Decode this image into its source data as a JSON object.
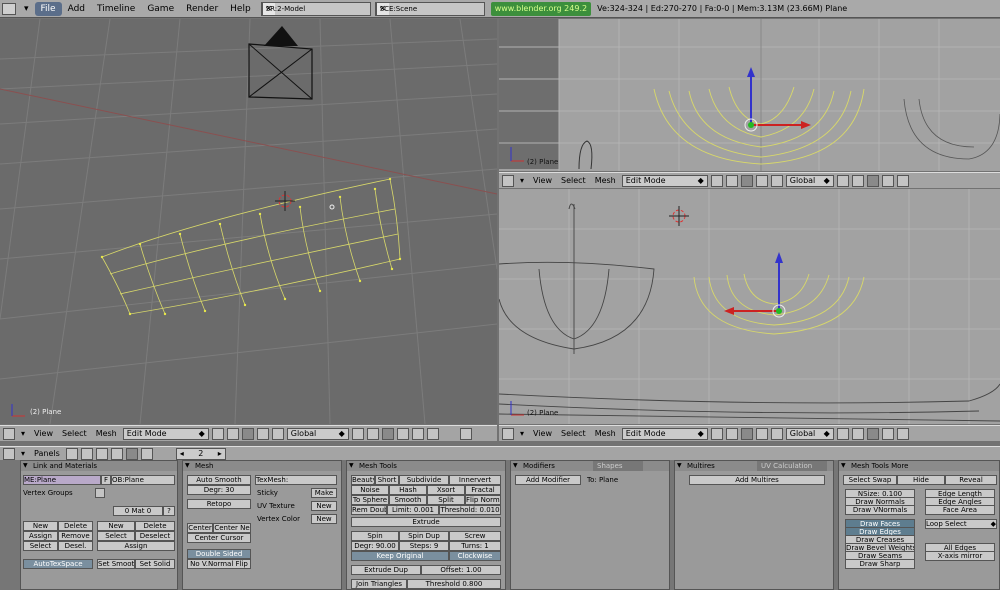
{
  "topbar": {
    "menus": [
      "File",
      "Add",
      "Timeline",
      "Game",
      "Render",
      "Help"
    ],
    "screen": "SR:2-Model",
    "scene": "SCE:Scene",
    "url": "www.blender.org 249.2",
    "stats": "Ve:324-324 | Ed:270-270 | Fa:0-0 | Mem:3.13M (23.66M) Plane"
  },
  "viewports": {
    "left": {
      "label": "(2) Plane"
    },
    "top_right": {
      "label": "(2) Plane"
    },
    "bottom_right": {
      "label": "(2) Plane"
    }
  },
  "header": {
    "view": "View",
    "select": "Select",
    "mesh": "Mesh",
    "mode": "Edit Mode",
    "orientation": "Global"
  },
  "buttons_header": {
    "panels": "Panels",
    "frame": "2"
  },
  "link_materials": {
    "title": "Link and Materials",
    "me": "ME:Plane",
    "f": "F",
    "ob": "OB:Plane",
    "vertex_groups": "Vertex Groups",
    "mat": "0 Mat 0",
    "q": "?",
    "new": "New",
    "delete": "Delete",
    "assign": "Assign",
    "remove": "Remove",
    "select": "Select",
    "desel": "Desel.",
    "deselect": "Deselect",
    "autotexspace": "AutoTexSpace",
    "set_smooth": "Set Smoot",
    "set_solid": "Set Solid"
  },
  "mesh": {
    "title": "Mesh",
    "auto_smooth": "Auto Smooth",
    "degr": "Degr: 30",
    "retopo": "Retopo",
    "center": "Center",
    "center_new": "Center Ne",
    "center_cursor": "Center Cursor",
    "double_sided": "Double Sided",
    "no_vnormal_flip": "No V.Normal Flip",
    "texmesh": "TexMesh:",
    "sticky": "Sticky",
    "make": "Make",
    "uv_texture": "UV Texture",
    "new1": "New",
    "vertex_color": "Vertex Color",
    "new2": "New"
  },
  "mesh_tools": {
    "title": "Mesh Tools",
    "beauty": "Beauty",
    "short": "Short",
    "subdivide": "Subdivide",
    "innervert": "Innervert",
    "noise": "Noise",
    "hash": "Hash",
    "xsort": "Xsort",
    "fractal": "Fractal",
    "to_sphere": "To Sphere",
    "smooth": "Smooth",
    "split": "Split",
    "flip_normal": "Flip Normal",
    "rem_doubl": "Rem Doubl",
    "limit": "Limit: 0.001",
    "threshold": "Threshold: 0.010",
    "extrude": "Extrude",
    "spin": "Spin",
    "spin_dup": "Spin Dup",
    "screw": "Screw",
    "degr": "Degr: 90.00",
    "steps": "Steps: 9",
    "turns": "Turns: 1",
    "keep_original": "Keep Original",
    "clockwise": "Clockwise",
    "extrude_dup": "Extrude Dup",
    "offset": "Offset: 1.00",
    "join_triangles": "Join Triangles",
    "threshold2": "Threshold 0.800"
  },
  "modifiers": {
    "title": "Modifiers",
    "shapes": "Shapes",
    "add_modifier": "Add Modifier",
    "to": "To: Plane"
  },
  "multires": {
    "title": "Multires",
    "uv_calc": "UV Calculation",
    "add_multires": "Add Multires"
  },
  "mesh_tools_more": {
    "title": "Mesh Tools More",
    "select_swap": "Select Swap",
    "hide": "Hide",
    "reveal": "Reveal",
    "nsize": "NSize: 0.100",
    "draw_normals": "Draw Normals",
    "draw_vnormals": "Draw VNormals",
    "edge_length": "Edge Length",
    "edge_angles": "Edge Angles",
    "face_area": "Face Area",
    "draw_faces": "Draw Faces",
    "draw_edges": "Draw Edges",
    "draw_creases": "Draw Creases",
    "draw_bevel": "Draw Bevel Weights",
    "draw_seams": "Draw Seams",
    "draw_sharp": "Draw Sharp",
    "loop_select": "Loop Select",
    "all_edges": "All Edges",
    "x_mirror": "X-axis mirror"
  },
  "colors": {
    "vertex": "#e8e84a",
    "wire": "#d8d86a",
    "bg": "#6f6f6f",
    "ortho_bg": "#9d9d9d"
  }
}
